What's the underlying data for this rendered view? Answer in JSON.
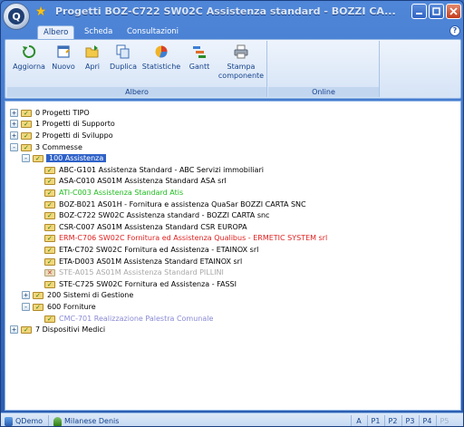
{
  "window": {
    "title": "Progetti BOZ-C722 SW02C Assistenza standard - BOZZI CA...",
    "app_icon": "q-logo-icon",
    "quick_access_icon": "star-icon"
  },
  "ribbon": {
    "tabs": [
      {
        "label": "Albero",
        "active": true
      },
      {
        "label": "Scheda",
        "active": false
      },
      {
        "label": "Consultazioni",
        "active": false
      }
    ],
    "groups": {
      "albero": {
        "label": "Albero",
        "buttons": [
          {
            "label": "Aggiorna",
            "icon": "refresh-icon"
          },
          {
            "label": "Nuovo",
            "icon": "new-document-icon"
          },
          {
            "label": "Apri",
            "icon": "open-folder-icon"
          },
          {
            "label": "Duplica",
            "icon": "duplicate-icon"
          },
          {
            "label": "Statistiche",
            "icon": "pie-chart-icon"
          },
          {
            "label": "Gantt",
            "icon": "gantt-chart-icon"
          },
          {
            "label_line1": "Stampa",
            "label_line2": "componente",
            "icon": "printer-icon"
          }
        ]
      },
      "online": {
        "label": "Online"
      }
    }
  },
  "tree": {
    "nodes": [
      {
        "level": 0,
        "toggle": "+",
        "label": "0 Progetti TIPO",
        "color": "default"
      },
      {
        "level": 0,
        "toggle": "+",
        "label": "1 Progetti di Supporto",
        "color": "default"
      },
      {
        "level": 0,
        "toggle": "+",
        "label": "2 Progetti di Sviluppo",
        "color": "default"
      },
      {
        "level": 0,
        "toggle": "-",
        "label": "3 Commesse",
        "color": "default"
      },
      {
        "level": 1,
        "toggle": "-",
        "label": "100 Assistenza",
        "color": "default",
        "selected": true
      },
      {
        "level": 2,
        "toggle": "",
        "label": "ABC-G101 Assistenza Standard - ABC Servizi immobiliari",
        "color": "default"
      },
      {
        "level": 2,
        "toggle": "",
        "label": "ASA-C010 AS01M Assistenza Standard ASA srl",
        "color": "default"
      },
      {
        "level": 2,
        "toggle": "",
        "label": "ATI-C003 Assistenza Standard Atis",
        "color": "green"
      },
      {
        "level": 2,
        "toggle": "",
        "label": "BOZ-B021 AS01H - Fornitura e assistenza QuaSar BOZZI CARTA SNC",
        "color": "default"
      },
      {
        "level": 2,
        "toggle": "",
        "label": "BOZ-C722 SW02C Assistenza standard - BOZZI CARTA snc",
        "color": "default"
      },
      {
        "level": 2,
        "toggle": "",
        "label": "CSR-C007 AS01M Assistenza Standard CSR EUROPA",
        "color": "default"
      },
      {
        "level": 2,
        "toggle": "",
        "label": "ERM-C706 SW02C Fornitura ed Assistenza Qualibus - ERMETIC SYSTEM srl",
        "color": "red"
      },
      {
        "level": 2,
        "toggle": "",
        "label": "ETA-C702 SW02C Fornitura ed Assistenza - ETAINOX srl",
        "color": "default"
      },
      {
        "level": 2,
        "toggle": "",
        "label": "ETA-D003 AS01M Assistenza Standard ETAINOX srl",
        "color": "default"
      },
      {
        "level": 2,
        "toggle": "",
        "label": "STE-A015 AS01M Assistenza Standard PILLINI",
        "color": "gray",
        "folder_style": "crossed"
      },
      {
        "level": 2,
        "toggle": "",
        "label": "STE-C725 SW02C Fornitura ed Assistenza - FASSI",
        "color": "default"
      },
      {
        "level": 1,
        "toggle": "+",
        "label": "200 Sistemi di Gestione",
        "color": "default"
      },
      {
        "level": 1,
        "toggle": "-",
        "label": "600 Forniture",
        "color": "default"
      },
      {
        "level": 2,
        "toggle": "",
        "label": "CMC-701 Realizzazione Palestra Comunale",
        "color": "lavender"
      },
      {
        "level": 0,
        "toggle": "+",
        "label": "7 Dispositivi Medici",
        "color": "default"
      }
    ]
  },
  "statusbar": {
    "user_db": "QDemo",
    "user_name": "Milanese Denis",
    "keys": [
      {
        "label": "A",
        "enabled": true
      },
      {
        "label": "P1",
        "enabled": true
      },
      {
        "label": "P2",
        "enabled": true
      },
      {
        "label": "P3",
        "enabled": true
      },
      {
        "label": "P4",
        "enabled": true
      },
      {
        "label": "P5",
        "enabled": false
      }
    ]
  }
}
